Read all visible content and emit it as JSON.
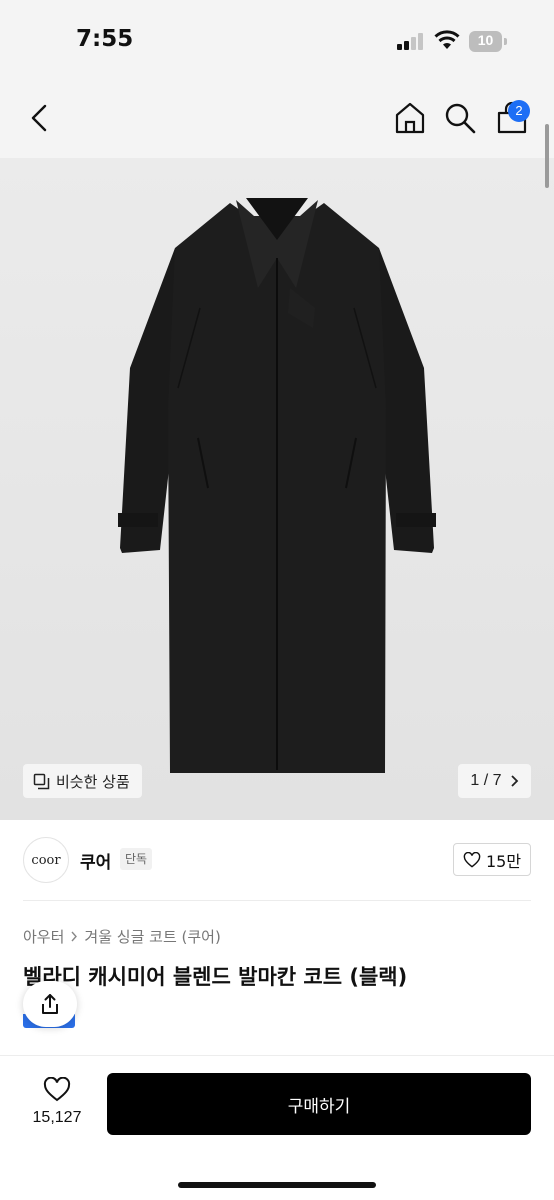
{
  "status_bar": {
    "time": "7:55",
    "battery": "10"
  },
  "header": {
    "cart_count": "2"
  },
  "product_image": {
    "similar_label": "비슷한 상품",
    "counter": "1 / 7"
  },
  "brand": {
    "logo_text": "coor",
    "name": "쿠어",
    "badge": "단독",
    "like_count": "15만"
  },
  "breadcrumb": {
    "category": "아우터",
    "subcategory": "겨울 싱글 코트 (쿠어)"
  },
  "product": {
    "title": "벨라디 캐시미어 블렌드 발마칸 코트 (블랙)"
  },
  "bottom_bar": {
    "wishlist_count": "15,127",
    "buy_label": "구매하기"
  },
  "colors": {
    "accent": "#1d6ef5",
    "buy_button": "#000000",
    "coat": "#1c1c1c"
  }
}
